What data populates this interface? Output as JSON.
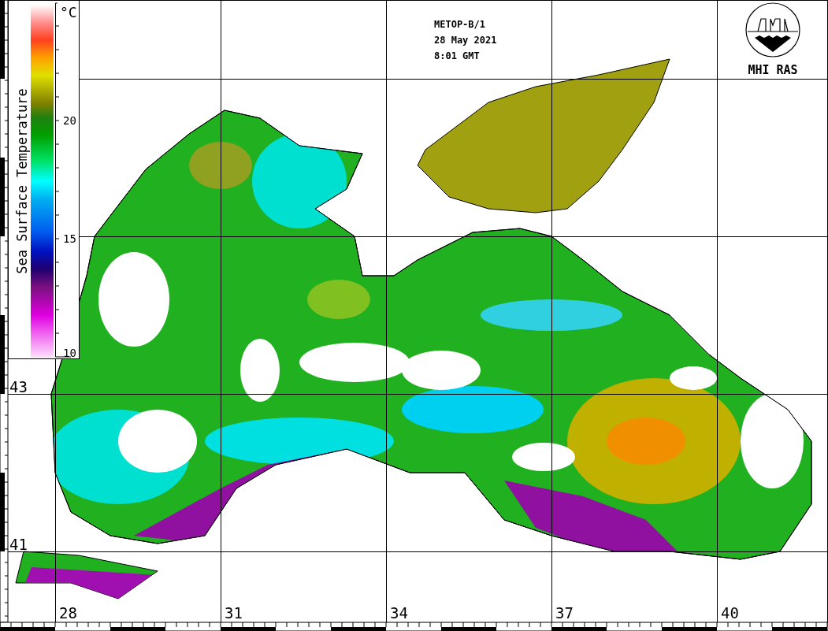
{
  "header": {
    "satellite": "METOP-B/1",
    "date": "28 May 2021",
    "time": "8:01 GMT"
  },
  "logo": {
    "text": "MHI RAS"
  },
  "color_scale": {
    "title": "Sea Surface Temperature",
    "unit": "°C",
    "ticks": [
      {
        "label": "20"
      },
      {
        "label": "15"
      },
      {
        "label": "10"
      }
    ]
  },
  "latitudes": [
    "43",
    "41"
  ],
  "longitudes": [
    "28",
    "31",
    "34",
    "37",
    "40"
  ]
}
